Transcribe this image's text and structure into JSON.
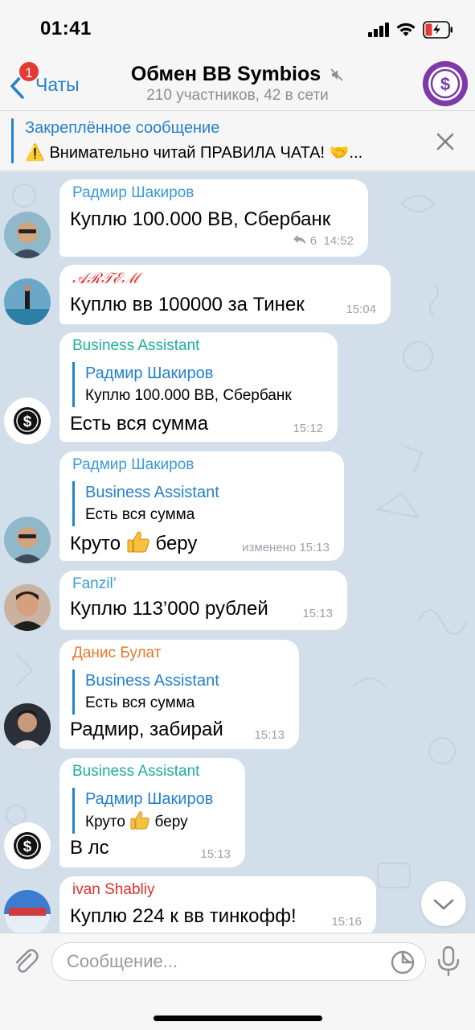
{
  "status": {
    "time": "01:41"
  },
  "nav": {
    "back_label": "Чаты",
    "badge": "1",
    "title": "Обмен BB Symbios",
    "subtitle": "210 участников, 42 в сети"
  },
  "pinned": {
    "title": "Закреплённое сообщение",
    "text": "⚠️ Внимательно читай ПРАВИЛА ЧАТА! 🤝..."
  },
  "messages": [
    {
      "sender": "Радмир Шакиров",
      "sender_color": "#3a9bd5",
      "text": "Куплю 100.000 BB, Сбербанк",
      "replies": "6",
      "time": "14:52"
    },
    {
      "sender": "𝒜ℛ𝒯ℰℳ",
      "sender_color": "#e0302e",
      "text": "Куплю вв 100000 за Тинек",
      "time": "15:04"
    },
    {
      "sender": "Business Assistant",
      "sender_color": "#1fae9b",
      "reply_name": "Радмир Шакиров",
      "reply_text": "Куплю 100.000 BB, Сбербанк",
      "text": "Есть вся сумма",
      "time": "15:12"
    },
    {
      "sender": "Радмир Шакиров",
      "sender_color": "#3a9bd5",
      "reply_name": "Business Assistant",
      "reply_text": "Есть вся сумма",
      "text_before": "Круто",
      "text_after": "беру",
      "edited": "изменено 15:13"
    },
    {
      "sender": "Fanzil’",
      "sender_color": "#3a9bd5",
      "text": "Куплю 113’000 рублей",
      "time": "15:13"
    },
    {
      "sender": "Данис Булат",
      "sender_color": "#e8792b",
      "reply_name": "Business Assistant",
      "reply_text": "Есть вся сумма",
      "text": "Радмир, забирай",
      "time": "15:13"
    },
    {
      "sender": "Business Assistant",
      "sender_color": "#1fae9b",
      "reply_name": "Радмир Шакиров",
      "reply_text_before": "Круто",
      "reply_text_after": "беру",
      "text": "В лс",
      "time": "15:13"
    },
    {
      "sender": "ivan Shabliy",
      "sender_color": "#e0302e",
      "text": "Куплю 224 к вв тинкофф!",
      "time": "15:16"
    }
  ],
  "input": {
    "placeholder": "Сообщение..."
  },
  "colors": {
    "accent": "#2481cc",
    "chat_bg": "#d2dee9",
    "bubble": "#ffffff",
    "badge": "#e53935"
  }
}
